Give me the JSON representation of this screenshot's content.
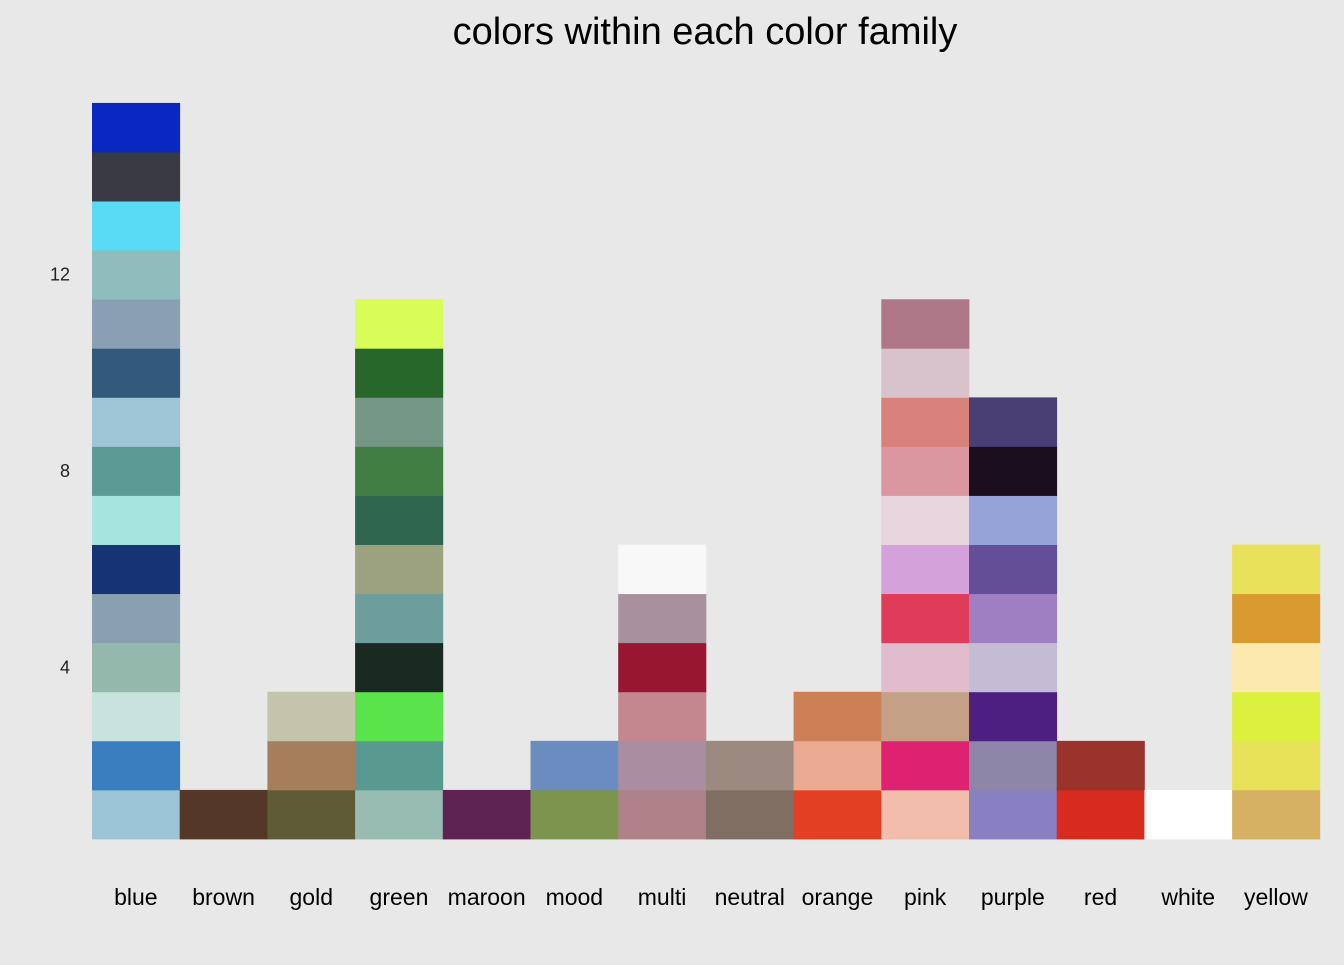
{
  "chart_data": {
    "type": "bar",
    "title": "colors within each color family",
    "xlabel": "",
    "ylabel": "",
    "ylim": [
      0,
      15
    ],
    "yticks": [
      "4",
      "8",
      "12"
    ],
    "grid": false,
    "categories": [
      "blue",
      "brown",
      "gold",
      "green",
      "maroon",
      "mood",
      "multi",
      "neutral",
      "orange",
      "pink",
      "purple",
      "red",
      "white",
      "yellow"
    ],
    "values": [
      15,
      1,
      3,
      11,
      1,
      2,
      6,
      2,
      3,
      11,
      9,
      2,
      1,
      6
    ],
    "stacks": {
      "blue": [
        "#9bc4d6",
        "#3a7ebf",
        "#c6e3de",
        "#94b8ab",
        "#8aa0b0",
        "#163474",
        "#a4e6df",
        "#5b9b93",
        "#9ec6d6",
        "#325a7c",
        "#8a9fb4",
        "#8fbcbd",
        "#59dbf5",
        "#393a44",
        "#0b27c1"
      ],
      "brown": [
        "#553728"
      ],
      "gold": [
        "#5e5c37",
        "#a67e5b",
        "#c4c4ad"
      ],
      "green": [
        "#98bbb2",
        "#589a8f",
        "#5be34b",
        "#1a2922",
        "#6d9e9d",
        "#9ca27f",
        "#2e6650",
        "#417e43",
        "#759785",
        "#27672a",
        "#d8fc58"
      ],
      "maroon": [
        "#5e2352"
      ],
      "mood": [
        "#7d944f",
        "#6b8cbf"
      ],
      "multi": [
        "#ae8288",
        "#a98ea2",
        "#c4868f",
        "#971731",
        "#a9909e",
        "#f7f8f7"
      ],
      "neutral": [
        "#816e62",
        "#9c8980"
      ],
      "orange": [
        "#e33f22",
        "#ebab93",
        "#cd7f56"
      ],
      "pink": [
        "#f3bdac",
        "#df2172",
        "#c4a086",
        "#e0bccd",
        "#e03b58",
        "#d4a1db",
        "#e8d5de",
        "#da979f",
        "#d8827b",
        "#d8c3cd",
        "#af7888"
      ],
      "purple": [
        "#8880c0",
        "#8e86a8",
        "#4c1f80",
        "#c4bcd5",
        "#a07ec2",
        "#634f97",
        "#96a3d9",
        "#1b0e1e",
        "#4a3f75"
      ],
      "red": [
        "#d82b20",
        "#9b332d"
      ],
      "white": [
        "#ffffff"
      ],
      "yellow": [
        "#d6b063",
        "#e8e258",
        "#dcf13f",
        "#fbe9ad",
        "#d99b2f",
        "#e9e15a"
      ]
    }
  }
}
